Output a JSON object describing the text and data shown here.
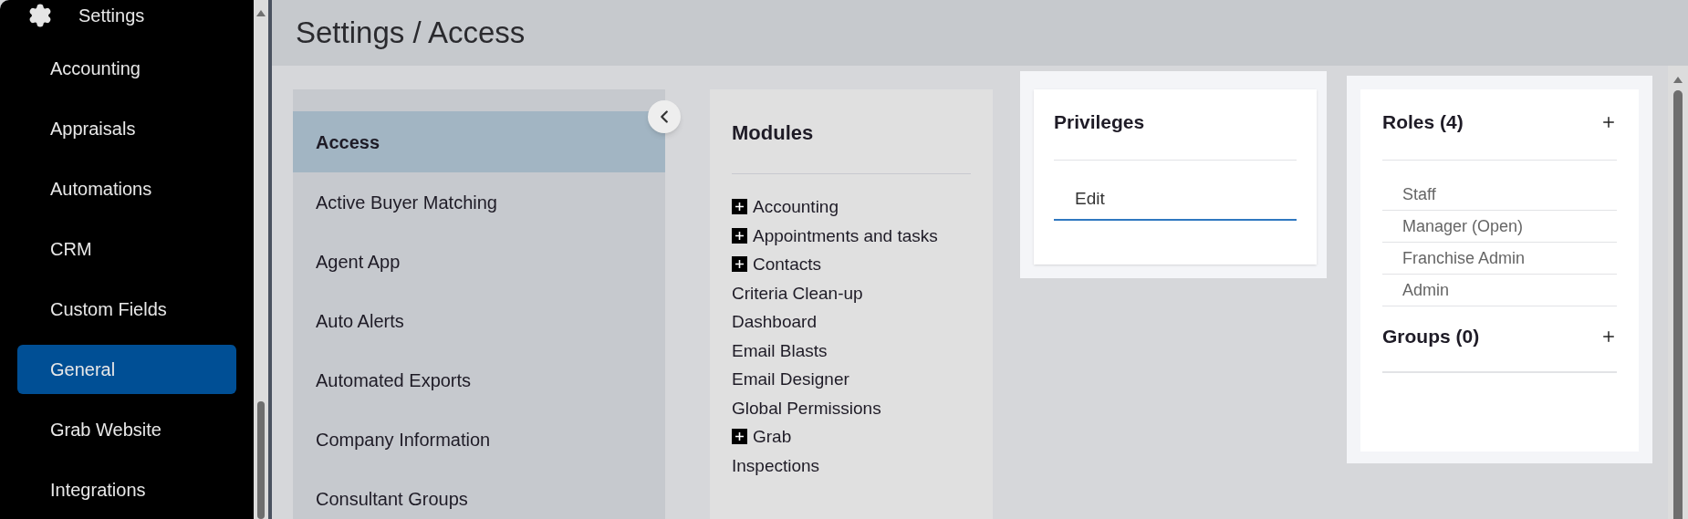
{
  "sidebar": {
    "header": "Settings",
    "items": [
      {
        "label": "Accounting",
        "selected": false
      },
      {
        "label": "Appraisals",
        "selected": false
      },
      {
        "label": "Automations",
        "selected": false
      },
      {
        "label": "CRM",
        "selected": false
      },
      {
        "label": "Custom Fields",
        "selected": false
      },
      {
        "label": "General",
        "selected": true
      },
      {
        "label": "Grab Website",
        "selected": false
      },
      {
        "label": "Integrations",
        "selected": false
      }
    ]
  },
  "page_title": "Settings / Access",
  "settings_list": {
    "items": [
      {
        "label": "Access",
        "selected": true
      },
      {
        "label": "Active Buyer Matching",
        "selected": false
      },
      {
        "label": "Agent App",
        "selected": false
      },
      {
        "label": "Auto Alerts",
        "selected": false
      },
      {
        "label": "Automated Exports",
        "selected": false
      },
      {
        "label": "Company Information",
        "selected": false
      },
      {
        "label": "Consultant Groups",
        "selected": false
      }
    ]
  },
  "modules": {
    "title": "Modules",
    "items": [
      {
        "label": "Accounting",
        "kind": "expandable"
      },
      {
        "label": "Appointments and tasks",
        "kind": "expandable"
      },
      {
        "label": "Contacts",
        "kind": "expandable"
      },
      {
        "label": "Criteria Clean-up",
        "kind": "plain"
      },
      {
        "label": "Dashboard",
        "kind": "plain"
      },
      {
        "label": "Email Blasts",
        "kind": "plain"
      },
      {
        "label": "Email Designer",
        "kind": "plain"
      },
      {
        "label": "Global Permissions",
        "kind": "plain"
      },
      {
        "label": "Grab",
        "kind": "expandable"
      },
      {
        "label": "Inspections",
        "kind": "plain"
      }
    ]
  },
  "privileges": {
    "title": "Privileges",
    "items": [
      {
        "label": "Edit",
        "selected": true
      }
    ]
  },
  "roles": {
    "title": "Roles (4)",
    "items": [
      "Staff",
      "Manager (Open)",
      "Franchise Admin",
      "Admin"
    ]
  },
  "groups": {
    "title": "Groups (0)"
  }
}
